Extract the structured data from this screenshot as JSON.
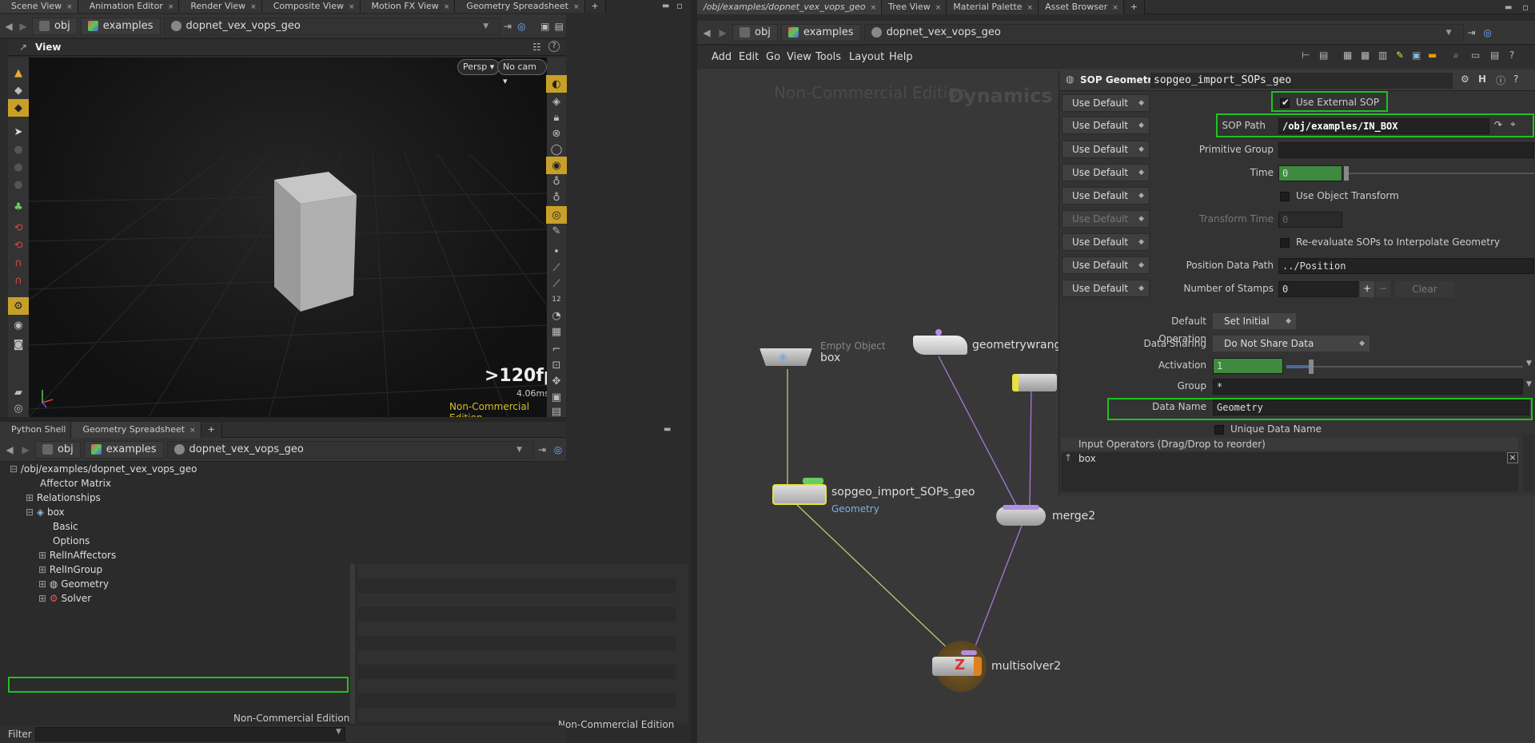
{
  "left_tabs": [
    "Scene View",
    "Animation Editor",
    "Render View",
    "Composite View",
    "Motion FX View",
    "Geometry Spreadsheet"
  ],
  "right_tabs": [
    "/obj/examples/dopnet_vex_vops_geo",
    "Tree View",
    "Material Palette",
    "Asset Browser"
  ],
  "path": {
    "obj": "obj",
    "examples": "examples",
    "net": "dopnet_vex_vops_geo"
  },
  "viewport": {
    "title": "View",
    "persp": "Persp",
    "cam": "No cam",
    "fps": ">120fps",
    "ms": "4.06ms",
    "edition": "Non-Commercial Edition"
  },
  "bottom_tabs": [
    "Python Shell",
    "Geometry Spreadsheet"
  ],
  "tree_items": [
    {
      "label": "/obj/examples/dopnet_vex_vops_geo",
      "indent": 0,
      "exp": "-"
    },
    {
      "label": "Affector Matrix",
      "indent": 1,
      "exp": ""
    },
    {
      "label": "Relationships",
      "indent": 1,
      "exp": "+"
    },
    {
      "label": "box",
      "indent": 1,
      "exp": "-"
    },
    {
      "label": "Basic",
      "indent": 2,
      "exp": ""
    },
    {
      "label": "Options",
      "indent": 2,
      "exp": ""
    },
    {
      "label": "RelInAffectors",
      "indent": 2,
      "exp": "+"
    },
    {
      "label": "RelInGroup",
      "indent": 2,
      "exp": "+"
    },
    {
      "label": "Geometry",
      "indent": 2,
      "exp": "+"
    },
    {
      "label": "Solver",
      "indent": 2,
      "exp": "+"
    }
  ],
  "spread_edition": "Non-Commercial Edition",
  "tree_edition": "Non-Commercial Edition",
  "filter_label": "Filter",
  "menus": [
    "Add",
    "Edit",
    "Go",
    "View",
    "Tools",
    "Layout",
    "Help"
  ],
  "net_watermark": "Non-Commercial Edition",
  "net_title": "Dynamics",
  "nodes": {
    "box": {
      "type": "Empty Object",
      "name": "box"
    },
    "wrangle": {
      "name": "geometrywrangle"
    },
    "sop": {
      "name": "sopgeo_import_SOPs_geo",
      "sub": "Geometry"
    },
    "merge": {
      "name": "merge2"
    },
    "solver": {
      "name": "multisolver2"
    }
  },
  "params": {
    "node_type": "SOP Geometry",
    "node_name": "sopgeo_import_SOPs_geo",
    "use_default": "Use Default",
    "use_external": "Use External SOP",
    "sop_path_label": "SOP Path",
    "sop_path": "/obj/examples/IN_BOX",
    "prim_group_label": "Primitive Group",
    "time_label": "Time",
    "time_value": "0",
    "use_obj_xform": "Use Object Transform",
    "xform_time_label": "Transform Time",
    "xform_time_value": "0",
    "reeval": "Re-evaluate SOPs to Interpolate Geometry",
    "pos_path_label": "Position Data Path",
    "pos_path": "../Position",
    "stamps_label": "Number of Stamps",
    "stamps_value": "0",
    "clear": "Clear",
    "default_op_label": "Default Operation",
    "default_op": "Set Initial",
    "data_sharing_label": "Data Sharing",
    "data_sharing": "Do Not Share Data",
    "activation_label": "Activation",
    "activation_value": "1",
    "activation_fill": 0.0,
    "group_label": "Group",
    "group_value": "*",
    "data_name_label": "Data Name",
    "data_name": "Geometry",
    "unique_data_name": "Unique Data Name",
    "input_ops": "Input Operators (Drag/Drop to reorder)",
    "input_item": "box"
  },
  "colors": {
    "highlight": "#1ec21e",
    "green_field": "#3e8a3e",
    "node_yellow": "#e8e23c",
    "wire_yellow": "#c8c86a",
    "wire_purple": "#a678d8"
  }
}
